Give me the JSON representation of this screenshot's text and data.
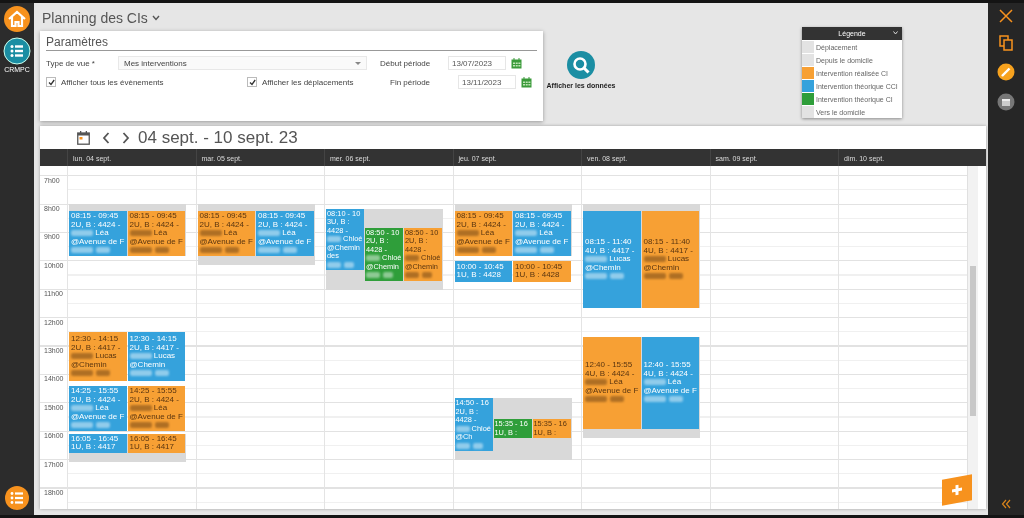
{
  "title": "Planning des CIs",
  "left_sidebar": {
    "label": "CRMPC"
  },
  "parameters": {
    "heading": "Paramètres",
    "view_type": {
      "label": "Type de vue *",
      "value": "Mes interventions"
    },
    "start": {
      "label": "Début période",
      "value": "13/07/2023"
    },
    "end": {
      "label": "Fin période",
      "value": "13/11/2023"
    },
    "checkboxes": [
      {
        "label": "Afficher tous les évènements",
        "checked": true
      },
      {
        "label": "Afficher les déplacements",
        "checked": true
      }
    ]
  },
  "search_button": {
    "label": "Afficher les données"
  },
  "legend": {
    "title": "Légende",
    "items": [
      {
        "label": "Déplacement",
        "color": "#e3e3e3"
      },
      {
        "label": "Depuis le domicile",
        "color": "#e3e3e3"
      },
      {
        "label": "Intervention réalisée CI",
        "color": "#f7a034"
      },
      {
        "label": "Intervention théorique CCI",
        "color": "#35a2dc"
      },
      {
        "label": "Intervention théorique CI",
        "color": "#2f9e3a"
      },
      {
        "label": "Vers le domicile",
        "color": "#e3e3e3"
      }
    ]
  },
  "calendar": {
    "range": "04 sept. - 10 sept. 23",
    "hours": [
      "7h00",
      "8h00",
      "9h00",
      "10h00",
      "11h00",
      "12h00",
      "13h00",
      "14h00",
      "15h00",
      "16h00",
      "17h00",
      "18h00"
    ],
    "days": [
      {
        "label": "lun. 04 sept.",
        "groups": [
          {
            "kind": "before",
            "events": [
              {
                "color": "#35a2dc",
                "time": "08:15 - 09:45",
                "before": "2U, B : 4424 -",
                "after": "Léa @Avenue de F",
                "redacted": true
              },
              {
                "color": "#f7a034",
                "time": "08:15 - 09:45",
                "before": "2U, B : 4424 -",
                "after": "Léa @Avenue de F",
                "redacted": true
              }
            ]
          },
          {
            "kind": "none",
            "events": [
              {
                "color": "#f7a034",
                "time": "12:30 - 14:15",
                "before": "2U, B : 4417 -",
                "after": "Lucas @Chemin",
                "redacted": true
              },
              {
                "color": "#35a2dc",
                "time": "12:30 - 14:15",
                "before": "2U, B : 4417 -",
                "after": "Lucas @Chemin",
                "redacted": true
              }
            ]
          },
          {
            "kind": "none",
            "events": [
              {
                "color": "#35a2dc",
                "time": "14:25 - 15:55",
                "before": "2U, B : 4424 -",
                "after": "Léa @Avenue de F",
                "redacted": true
              },
              {
                "color": "#f7a034",
                "time": "14:25 - 15:55",
                "before": "2U, B : 4424 -",
                "after": "Léa @Avenue de F",
                "redacted": true
              }
            ]
          },
          {
            "kind": "after",
            "events": [
              {
                "color": "#35a2dc",
                "time": "16:05 - 16:45",
                "before": "1U, B : 4417",
                "redacted": false
              },
              {
                "color": "#f7a034",
                "time": "16:05 - 16:45",
                "before": "1U, B : 4417",
                "redacted": false
              }
            ]
          }
        ]
      },
      {
        "label": "mar. 05 sept.",
        "groups": [
          {
            "kind": "both",
            "events": [
              {
                "color": "#f7a034",
                "time": "08:15 - 09:45",
                "before": "2U, B : 4424 -",
                "after": "Léa @Avenue de F",
                "redacted": true
              },
              {
                "color": "#35a2dc",
                "time": "08:15 - 09:45",
                "before": "2U, B : 4424 -",
                "after": "Léa @Avenue de F",
                "redacted": true
              }
            ]
          }
        ]
      },
      {
        "label": "mer. 06 sept.",
        "groups": [
          {
            "kind": "after",
            "events": [
              {
                "color": "#35a2dc",
                "time": "08:10 - 10",
                "before": "3U, B : 4428 -",
                "after": "Chloé @Chemin des",
                "redacted": true
              },
              {
                "color": "#2f9e3a",
                "time": "08:50 - 10",
                "before": "2U, B : 4428 -",
                "after": "Chloé @Chemin",
                "redacted": true
              },
              {
                "color": "#f7a034",
                "time": "08:50 - 10",
                "before": "2U, B : 4428 -",
                "after": "Chloé @Chemin",
                "redacted": true
              }
            ]
          }
        ]
      },
      {
        "label": "jeu. 07 sept.",
        "groups": [
          {
            "kind": "before",
            "events": [
              {
                "color": "#f7a034",
                "time": "08:15 - 09:45",
                "before": "2U, B : 4424 -",
                "after": "Léa @Avenue de F",
                "redacted": true
              },
              {
                "color": "#35a2dc",
                "time": "08:15 - 09:45",
                "before": "2U, B : 4424 -",
                "after": "Léa @Avenue de F",
                "redacted": true
              }
            ]
          },
          {
            "kind": "none",
            "events": [
              {
                "color": "#35a2dc",
                "time": "10:00 - 10:45",
                "before": "1U, B : 4428",
                "redacted": false
              },
              {
                "color": "#f7a034",
                "time": "10:00 - 10:45",
                "before": "1U, B : 4428",
                "redacted": false
              }
            ]
          },
          {
            "kind": "after",
            "events": [
              {
                "color": "#35a2dc",
                "time": "14:50 - 16",
                "before": "2U, B : 4428 -",
                "after": "Chloé @Ch",
                "redacted": true
              },
              {
                "color": "#2f9e3a",
                "time": "15:35 - 16",
                "before": "1U, B :",
                "redacted": false
              },
              {
                "color": "#f7a034",
                "time": "15:35 - 16",
                "before": "1U, B :",
                "redacted": false
              }
            ]
          }
        ]
      },
      {
        "label": "ven. 08 sept.",
        "groups": [
          {
            "kind": "before",
            "events": [
              {
                "color": "#35a2dc",
                "time": "08:15 - 11:40",
                "before": "4U, B : 4417 -",
                "after": "Lucas @Chemin",
                "redacted": true
              },
              {
                "color": "#f7a034",
                "time": "08:15 - 11:40",
                "before": "4U, B : 4417 -",
                "after": "Lucas @Chemin",
                "redacted": true
              }
            ]
          },
          {
            "kind": "after",
            "events": [
              {
                "color": "#f7a034",
                "time": "12:40 - 15:55",
                "before": "4U, B : 4424 -",
                "after": "Léa @Avenue de F",
                "redacted": true
              },
              {
                "color": "#35a2dc",
                "time": "12:40 - 15:55",
                "before": "4U, B : 4424 -",
                "after": "Léa @Avenue de F",
                "redacted": true
              }
            ]
          }
        ]
      },
      {
        "label": "sam. 09 sept."
      },
      {
        "label": "dim. 10 sept."
      }
    ]
  }
}
